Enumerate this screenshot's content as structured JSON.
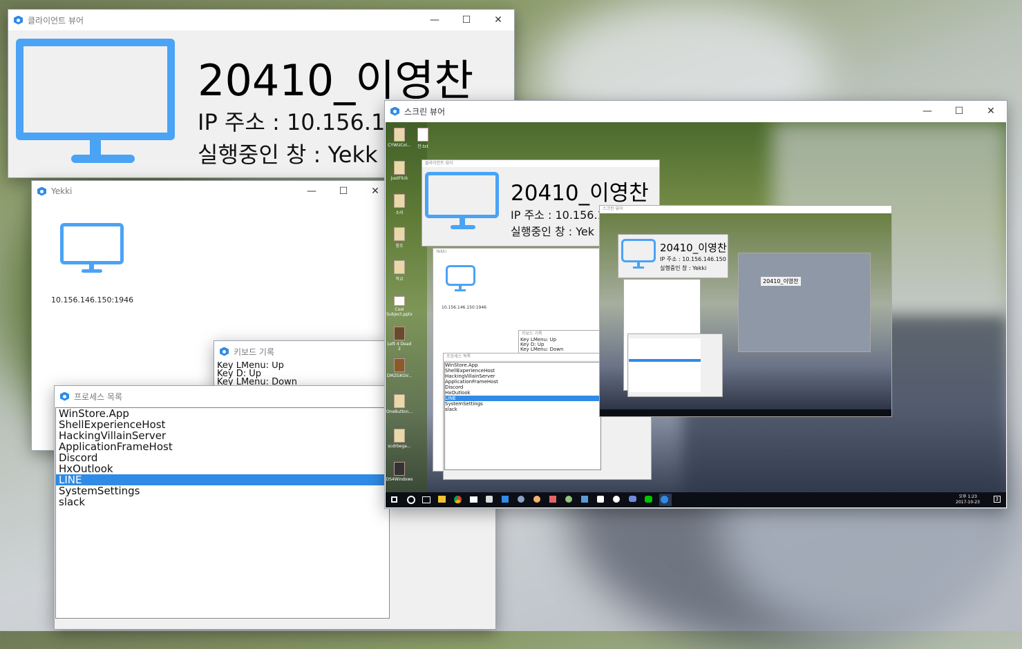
{
  "client_viewer": {
    "title": "클라이언트 뷰어",
    "student": "20410_이영찬",
    "ip_line": "IP 주소 : 10.156.14",
    "window_line": "실행중인 창 : Yekk"
  },
  "yekki_window": {
    "title": "Yekki",
    "client_address": "10.156.146.150:1946"
  },
  "keyboard_log": {
    "title": "키보드 기록",
    "lines": [
      "Key LMenu: Up",
      "Key D: Up",
      "Key LMenu: Down"
    ]
  },
  "process_list": {
    "title": "프로세스 목록",
    "items": [
      "WinStore.App",
      "ShellExperienceHost",
      "HackingVillainServer",
      "ApplicationFrameHost",
      "Discord",
      "HxOutlook",
      "LINE",
      "SystemSettings",
      "slack"
    ],
    "selected": "LINE"
  },
  "screen_viewer": {
    "title": "스크린 뷰어",
    "desktop_icons": [
      "CYWUCoI...",
      "잔.txt",
      "JustFlick",
      "소리",
      "창조",
      "학교",
      "Cool Subject.pptx",
      "Left 4 Dead 2",
      "DMZGKGV...",
      "OneButton...",
      "scdrbega...",
      "DS4Windows"
    ],
    "nested_client": {
      "title": "클라이언트 뷰어",
      "student": "20410_이영찬",
      "ip_line": "IP 주소 : 10.156.14",
      "window_line": "실행중인 창 : Yek"
    },
    "nested_yekki": {
      "title": "Yekki",
      "client_address": "10.156.146.150:1946"
    },
    "nested_keyboard": {
      "title": "키보드 기록",
      "lines": [
        "Key LMenu: Up",
        "Key D: Up",
        "Key LMenu: Down"
      ]
    },
    "nested_process": {
      "title": "프로세스 목록"
    },
    "nested_screen": {
      "title": "스크린 뷰어",
      "client_student": "20410_이영찬",
      "client_ip": "IP 주소 : 10.156.146.150",
      "client_window": "실행중인 창 : Yekki",
      "deeper_student": "20410_이영찬"
    },
    "clock_time": "오후 1:23",
    "clock_date": "2017-10-23",
    "notification_count": "3"
  },
  "window_controls": {
    "minimize": "—",
    "maximize": "☐",
    "close": "✕"
  },
  "colors": {
    "accent": "#2f8be6",
    "monitor": "#4aa3f5"
  },
  "icons": [
    "app-icon",
    "monitor-icon",
    "minimize-icon",
    "maximize-icon",
    "close-icon"
  ]
}
